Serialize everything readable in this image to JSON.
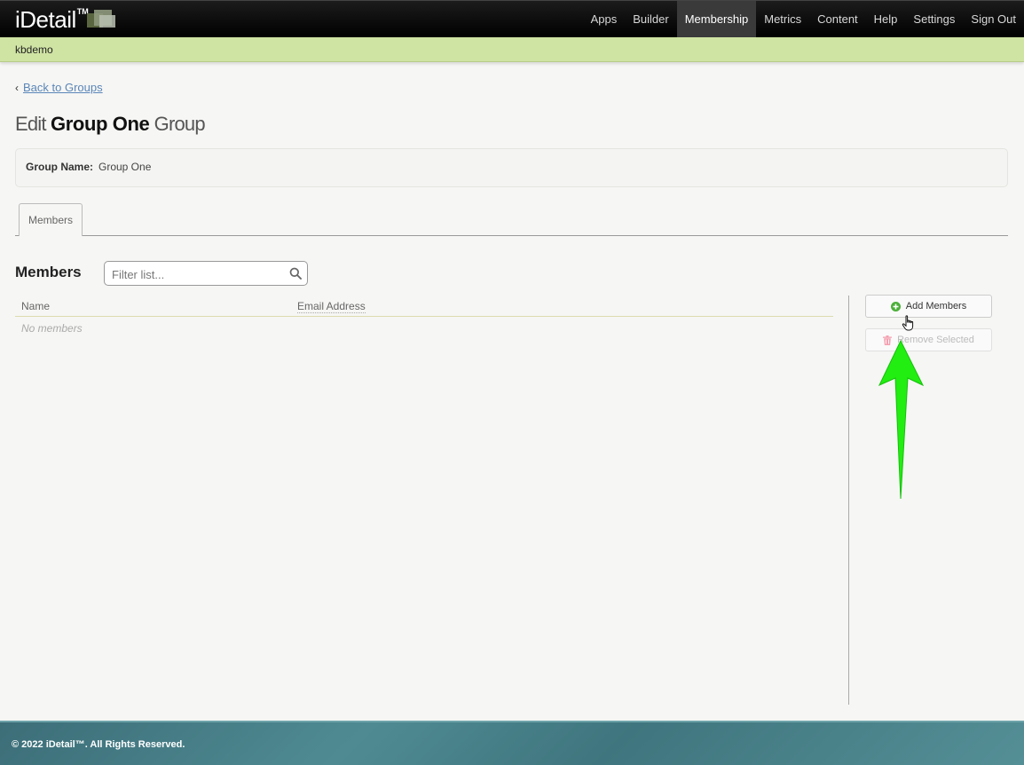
{
  "header": {
    "logo_text": "iDetail",
    "logo_tm": "TM",
    "nav": [
      "Apps",
      "Builder",
      "Membership",
      "Metrics",
      "Content",
      "Help",
      "Settings",
      "Sign Out"
    ],
    "active_nav": "Membership"
  },
  "subbar": {
    "account": "kbdemo"
  },
  "page": {
    "back_label": "Back to Groups",
    "title_prefix": "Edit",
    "title_name": "Group One",
    "title_suffix": "Group",
    "group_name_label": "Group Name:",
    "group_name_value": "Group One",
    "tab_label": "Members"
  },
  "members": {
    "heading": "Members",
    "filter_placeholder": "Filter list...",
    "columns": [
      "Name",
      "Email Address"
    ],
    "empty_text": "No members",
    "add_button": "Add Members",
    "remove_button": "Remove Selected"
  },
  "footer": {
    "copyright": "© 2022 iDetail™.  All Rights Reserved."
  },
  "colors": {
    "accent_green": "#22ee11",
    "subbar": "#cfe3a3",
    "link": "#5a86b8",
    "footer": "#3f757e"
  }
}
